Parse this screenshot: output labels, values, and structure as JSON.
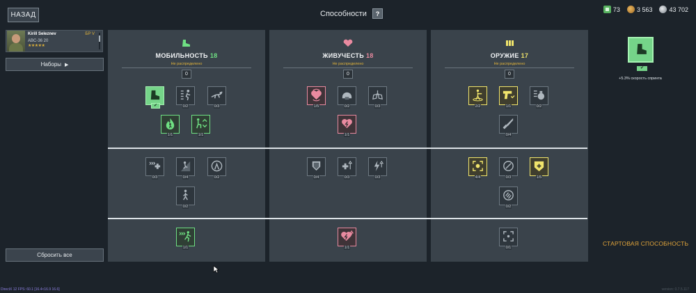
{
  "header": {
    "back_label": "НАЗАД",
    "title": "Способности",
    "help_label": "?",
    "currencies": [
      {
        "icon": "green-cash-icon",
        "value": "73"
      },
      {
        "icon": "gold-coin-icon",
        "value": "3 563"
      },
      {
        "icon": "silver-coin-icon",
        "value": "43 702"
      }
    ]
  },
  "character": {
    "name": "Kirill Seleznev",
    "rank": "БР V",
    "class": "ABC-36 20",
    "stars": "★★★★★"
  },
  "sidebar": {
    "sets_label": "Наборы",
    "reset_label": "Сбросить все"
  },
  "columns": [
    {
      "title": "МОБИЛЬНОСТЬ",
      "points": "18",
      "points_color": "#6fe083",
      "subtitle": "Не распределено",
      "unassigned": "0",
      "tier1": [
        "",
        "0/2",
        "0/3",
        "1/1",
        "1/1"
      ],
      "tier2": [
        "0/3",
        "0/4",
        "0/2",
        "0/2"
      ],
      "tier3": [
        "1/1"
      ]
    },
    {
      "title": "ЖИВУЧЕСТЬ",
      "points": "18",
      "points_color": "#e98aa0",
      "subtitle": "Не распределено",
      "unassigned": "0",
      "tier1": [
        "1/5",
        "0/2",
        "0/3",
        "1/1"
      ],
      "tier2": [
        "0/4",
        "0/3",
        "0/3"
      ],
      "tier3": [
        "1/1"
      ]
    },
    {
      "title": "ОРУЖИЕ",
      "points": "17",
      "points_color": "#f1e56c",
      "subtitle": "Не распределено",
      "unassigned": "0",
      "tier1": [
        "2/2",
        "1/1",
        "0/2",
        "0/4"
      ],
      "tier2": [
        "4/4",
        "0/3",
        "1/5",
        "0/2"
      ],
      "tier3": [
        "0/1"
      ]
    }
  ],
  "selected": {
    "icon": "sprint-boot-icon",
    "description": "+5.3% скорость спринта"
  },
  "start_ability_label": "СТАРТОВАЯ СПОСОБНОСТЬ",
  "debug_text": "DirectX 12 FPS: 60.1 [16.4<16.9 16.6]",
  "version_text": "version: 0.7.5.117"
}
